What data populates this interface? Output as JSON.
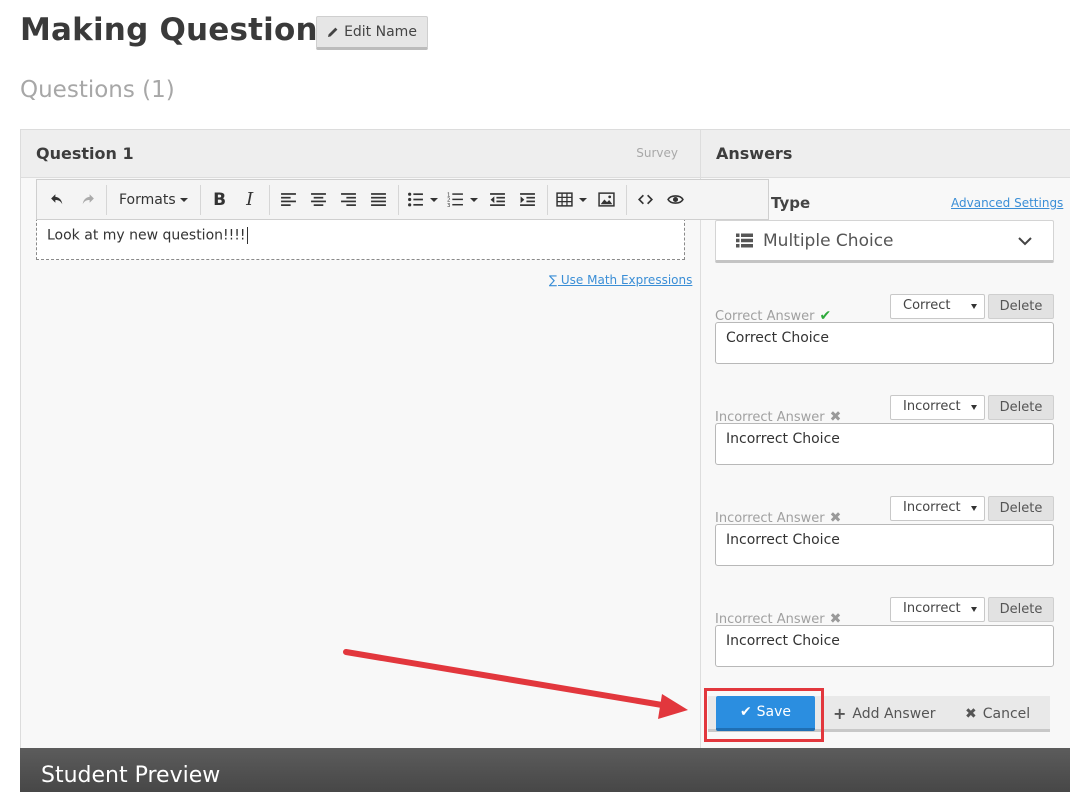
{
  "page": {
    "title": "Making Questions",
    "edit_name_label": "Edit Name",
    "section_title": "Questions (1)"
  },
  "question": {
    "title": "Question 1",
    "type": "Survey",
    "toolbar": {
      "formats_label": "Formats",
      "bold": "B",
      "italic": "I"
    },
    "editor_text": "Look at my new question!!!!",
    "math_link": "∑ Use Math Expressions"
  },
  "answers": {
    "title": "Answers",
    "type_label": "Type",
    "advanced_settings": "Advanced Settings",
    "type_value": "Multiple Choice",
    "delete_label": "Delete",
    "items": [
      {
        "label": "Correct Answer",
        "mark": "✔",
        "status": "Correct",
        "value": "Correct Choice"
      },
      {
        "label": "Incorrect Answer",
        "mark": "✖",
        "status": "Incorrect",
        "value": "Incorrect Choice"
      },
      {
        "label": "Incorrect Answer",
        "mark": "✖",
        "status": "Incorrect",
        "value": "Incorrect Choice"
      },
      {
        "label": "Incorrect Answer",
        "mark": "✖",
        "status": "Incorrect",
        "value": "Incorrect Choice"
      }
    ]
  },
  "actions": {
    "save_label": "Save",
    "add_answer_label": "Add Answer",
    "cancel_label": "Cancel"
  },
  "preview": {
    "title": "Student Preview"
  },
  "colors": {
    "accent": "#2b8ee0",
    "annotation": "#e2373d",
    "correct": "#2eaa3b"
  },
  "icons": [
    "pencil-icon",
    "undo-icon",
    "redo-icon",
    "align-left-icon",
    "align-center-icon",
    "align-right-icon",
    "justify-icon",
    "bullet-list-icon",
    "numbered-list-icon",
    "outdent-icon",
    "indent-icon",
    "table-icon",
    "image-icon",
    "code-icon",
    "eye-icon",
    "list-icon",
    "chevron-down-icon",
    "check-icon",
    "plus-icon",
    "times-icon"
  ]
}
